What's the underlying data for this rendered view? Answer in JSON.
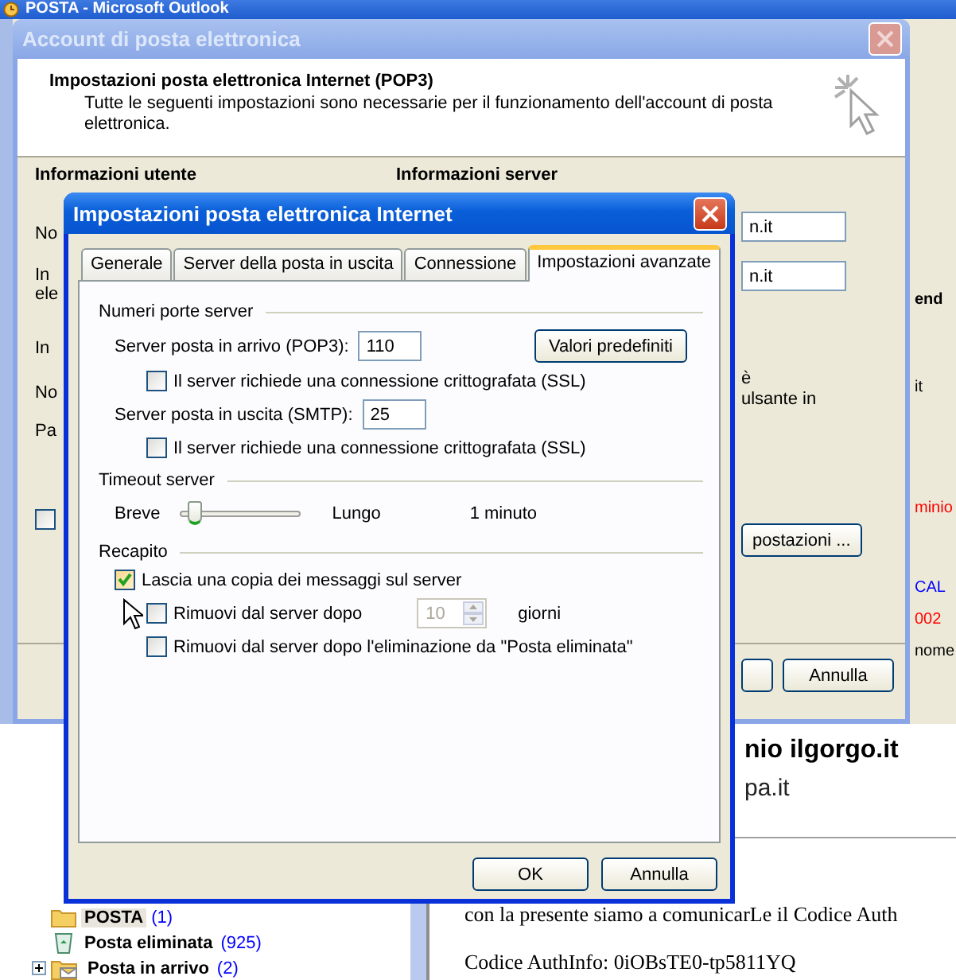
{
  "outlook": {
    "title": "POSTA - Microsoft Outlook",
    "right_fragments": [
      {
        "text": "end",
        "bold": true,
        "color": "#000000"
      },
      {
        "text": "it",
        "bold": false,
        "color": "#000000"
      },
      {
        "text": "minio",
        "bold": false,
        "color": "#ff0000"
      },
      {
        "text": "CAL",
        "bold": false,
        "color": "#0000ff"
      },
      {
        "text": "002",
        "bold": false,
        "color": "#ff0000"
      },
      {
        "text": "nome",
        "bold": false,
        "color": "#000000"
      }
    ],
    "folders": [
      {
        "name": "POSTA",
        "count": "(1)",
        "kind": "folder",
        "selected": true,
        "expandable": false
      },
      {
        "name": "Posta eliminata",
        "count": "(925)",
        "kind": "trash",
        "selected": false,
        "expandable": false
      },
      {
        "name": "Posta in arrivo",
        "count": "(2)",
        "kind": "inbox",
        "selected": false,
        "expandable": true
      }
    ],
    "reading_pane": {
      "sender": "nio ilgorgo.it",
      "address": "pa.it",
      "body": [
        "con la presente siamo a comunicarLe il Codice Auth",
        "Codice AuthInfo: 0iOBsTE0-tp5811YQ"
      ]
    }
  },
  "account_dialog": {
    "title": "Account di posta elettronica",
    "heading": "Impostazioni posta elettronica Internet (POP3)",
    "description": "Tutte le seguenti impostazioni sono necessarie per il funzionamento dell'account di posta elettronica.",
    "sections": [
      "Informazioni utente",
      "Informazioni server"
    ],
    "label_fragments": [
      "No",
      "In",
      "ele",
      "In",
      "No",
      "Pa"
    ],
    "field_values": [
      "n.it",
      "n.it"
    ],
    "text_fragments": [
      "è",
      "ulsante in"
    ],
    "checkbox": {
      "checked": false
    },
    "more_button": "postazioni ...",
    "cancel_button": "Annulla"
  },
  "settings_dialog": {
    "title": "Impostazioni posta elettronica Internet",
    "tabs": [
      {
        "label": "Generale",
        "selected": false
      },
      {
        "label": "Server della posta in uscita",
        "selected": false
      },
      {
        "label": "Connessione",
        "selected": false
      },
      {
        "label": "Impostazioni avanzate",
        "selected": true
      }
    ],
    "ports": {
      "heading": "Numeri porte server",
      "incoming_label": "Server posta in arrivo (POP3):",
      "incoming_value": "110",
      "incoming_ssl": {
        "label": "Il server richiede una connessione crittografata (SSL)",
        "checked": false
      },
      "outgoing_label": "Server posta in uscita (SMTP):",
      "outgoing_value": "25",
      "outgoing_ssl": {
        "label": "Il server richiede una connessione crittografata (SSL)",
        "checked": false
      },
      "defaults_button": "Valori predefiniti"
    },
    "timeout": {
      "heading": "Timeout server",
      "min_label": "Breve",
      "max_label": "Lungo",
      "level": 0.1,
      "reading": "1 minuto"
    },
    "delivery": {
      "heading": "Recapito",
      "leave_copy": {
        "label": "Lascia una copia dei messaggi sul server",
        "checked": true
      },
      "remove_after": {
        "label": "Rimuovi dal server dopo",
        "checked": false,
        "days": "10",
        "disabled": true,
        "unit": "giorni"
      },
      "remove_on_delete": {
        "label": "Rimuovi dal server dopo l'eliminazione da \"Posta eliminata\"",
        "checked": false
      }
    },
    "buttons": [
      "OK",
      "Annulla"
    ]
  }
}
